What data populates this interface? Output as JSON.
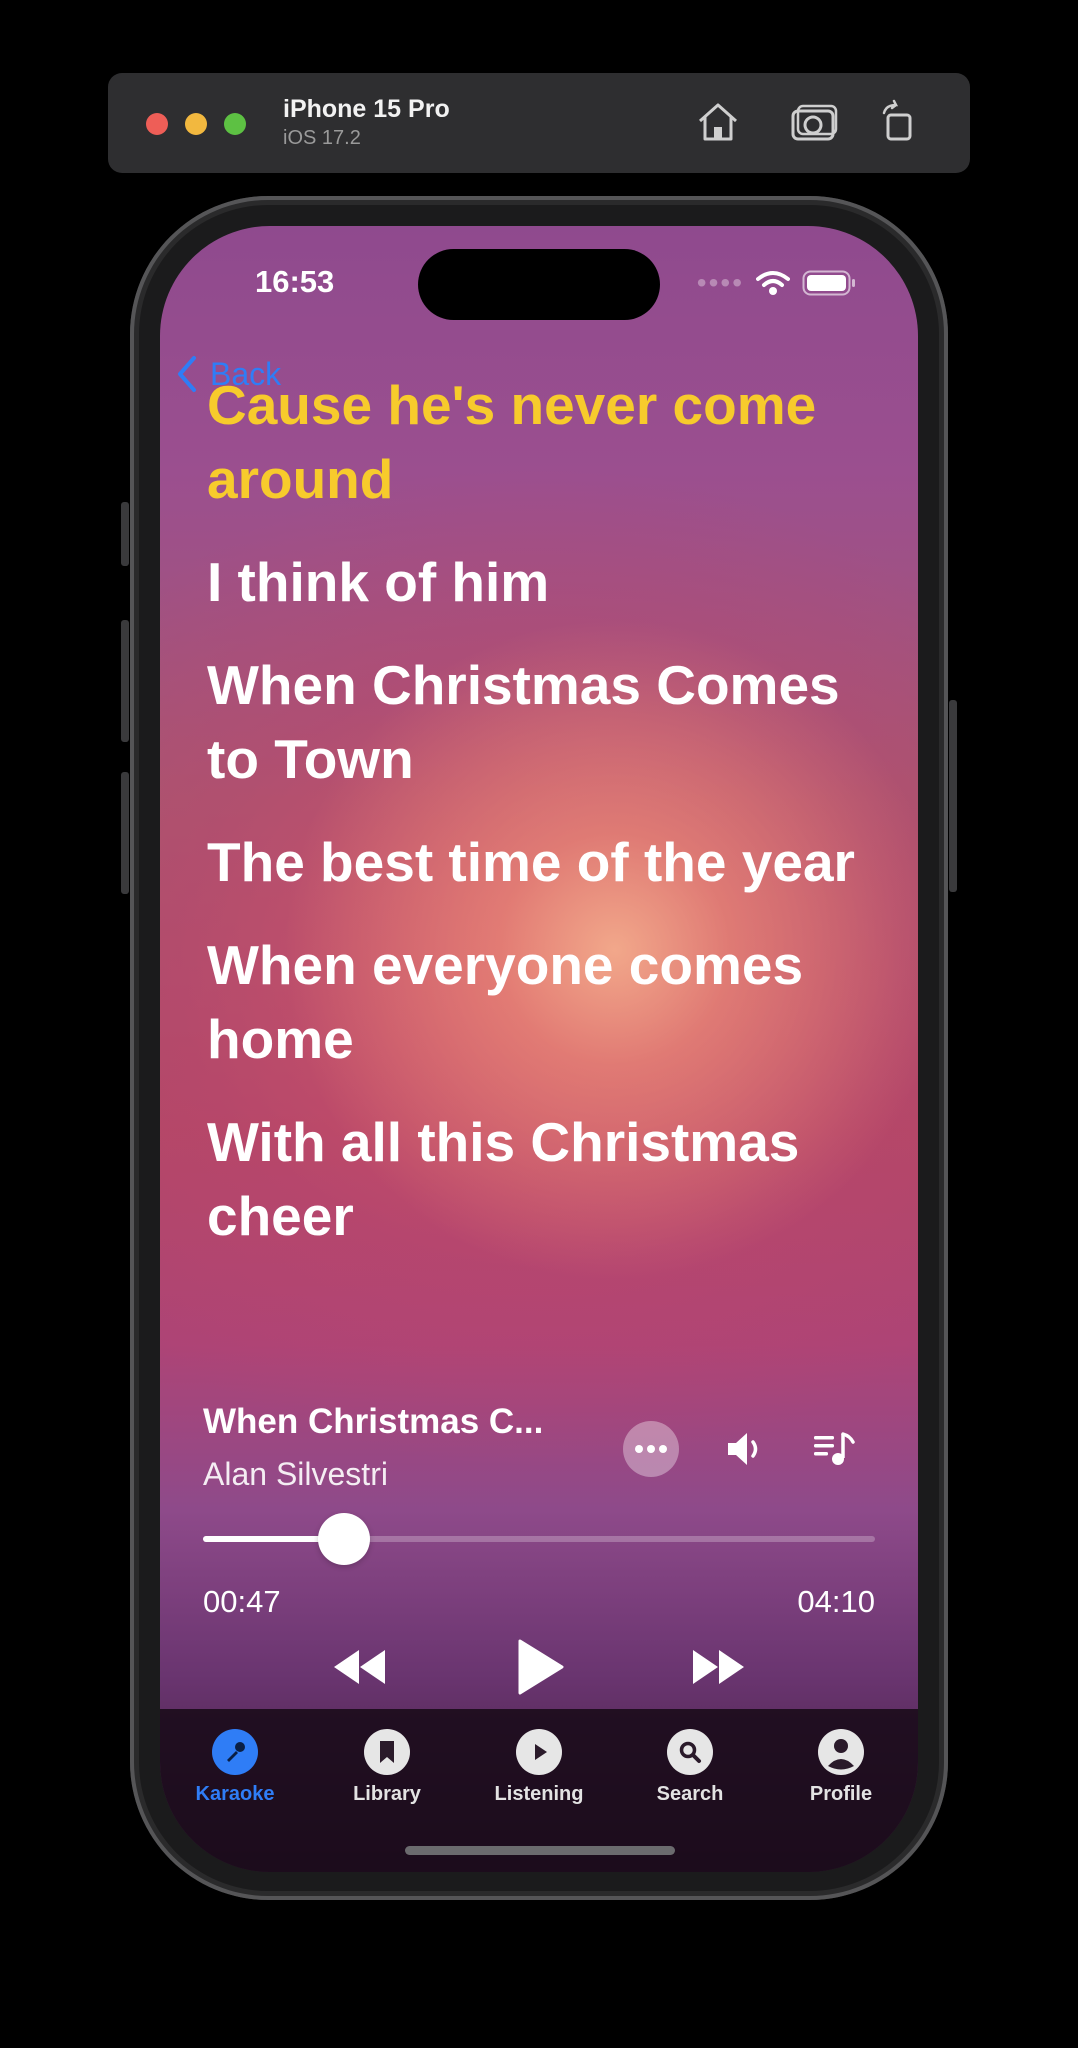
{
  "simulator": {
    "device_name": "iPhone 15 Pro",
    "os_version": "iOS 17.2",
    "home_icon": "home-icon",
    "screenshot_icon": "camera-icon",
    "rotate_icon": "rotate-icon"
  },
  "status_bar": {
    "time": "16:53",
    "wifi_icon": "wifi-icon",
    "battery_icon": "battery-icon"
  },
  "nav": {
    "back_label": "Back"
  },
  "lyrics": [
    {
      "text": "Cause he's never come around",
      "active": true
    },
    {
      "text": "I think of him",
      "active": false
    },
    {
      "text": "When Christmas Comes to Town",
      "active": false
    },
    {
      "text": "The best time of the year",
      "active": false
    },
    {
      "text": "When everyone comes home",
      "active": false
    },
    {
      "text": "With all this Christmas cheer",
      "active": false
    }
  ],
  "now_playing": {
    "title": "When Christmas C...",
    "artist": "Alan Silvestri",
    "elapsed": "00:47",
    "duration": "04:10",
    "progress": 0.21,
    "more_icon": "ellipsis-icon",
    "volume_icon": "speaker-icon",
    "queue_icon": "queue-music-icon",
    "rewind_icon": "rewind-icon",
    "play_icon": "play-icon",
    "forward_icon": "fast-forward-icon"
  },
  "tabs": [
    {
      "label": "Karaoke",
      "icon": "microphone-icon",
      "active": true
    },
    {
      "label": "Library",
      "icon": "bookmark-icon",
      "active": false
    },
    {
      "label": "Listening",
      "icon": "play-circle-icon",
      "active": false
    },
    {
      "label": "Search",
      "icon": "search-icon",
      "active": false
    },
    {
      "label": "Profile",
      "icon": "person-icon",
      "active": false
    }
  ],
  "colors": {
    "accent": "#2f7df6",
    "active_lyric": "#f7cb2c",
    "lyric": "#ffffff"
  }
}
